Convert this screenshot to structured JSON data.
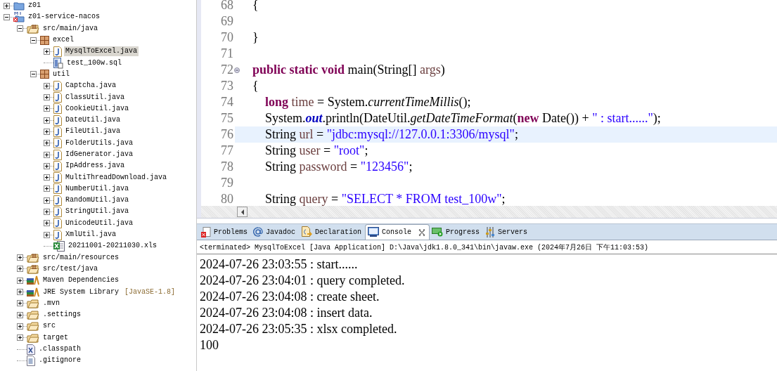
{
  "project_explorer": {
    "items": [
      {
        "label": "z01",
        "kind": "project",
        "expanded": false,
        "selected": false
      },
      {
        "label": "z01-service-nacos",
        "kind": "maven-project",
        "expanded": true,
        "selected": false,
        "children": [
          {
            "label": "src/main/java",
            "kind": "source-folder",
            "expanded": true,
            "selected": false,
            "children": [
              {
                "label": "excel",
                "kind": "package",
                "expanded": true,
                "selected": false,
                "children": [
                  {
                    "label": "MysqlToExcel.java",
                    "kind": "java",
                    "expanded": false,
                    "selected": true
                  },
                  {
                    "label": "test_100w.sql",
                    "kind": "sql",
                    "selected": false
                  }
                ]
              },
              {
                "label": "util",
                "kind": "package",
                "expanded": true,
                "selected": false,
                "children": [
                  {
                    "label": "Captcha.java",
                    "kind": "java",
                    "expanded": false,
                    "selected": false
                  },
                  {
                    "label": "ClassUtil.java",
                    "kind": "java",
                    "expanded": false,
                    "selected": false
                  },
                  {
                    "label": "CookieUtil.java",
                    "kind": "java",
                    "expanded": false,
                    "selected": false
                  },
                  {
                    "label": "DateUtil.java",
                    "kind": "java",
                    "expanded": false,
                    "selected": false
                  },
                  {
                    "label": "FileUtil.java",
                    "kind": "java",
                    "expanded": false,
                    "selected": false
                  },
                  {
                    "label": "FolderUtils.java",
                    "kind": "java",
                    "expanded": false,
                    "selected": false
                  },
                  {
                    "label": "IdGenerator.java",
                    "kind": "java",
                    "expanded": false,
                    "selected": false
                  },
                  {
                    "label": "IpAddress.java",
                    "kind": "java",
                    "expanded": false,
                    "selected": false
                  },
                  {
                    "label": "MultiThreadDownload.java",
                    "kind": "java",
                    "expanded": false,
                    "selected": false
                  },
                  {
                    "label": "NumberUtil.java",
                    "kind": "java",
                    "expanded": false,
                    "selected": false
                  },
                  {
                    "label": "RandomUtil.java",
                    "kind": "java",
                    "expanded": false,
                    "selected": false
                  },
                  {
                    "label": "StringUtil.java",
                    "kind": "java",
                    "expanded": false,
                    "selected": false
                  },
                  {
                    "label": "UnicodeUtil.java",
                    "kind": "java",
                    "expanded": false,
                    "selected": false
                  },
                  {
                    "label": "XmlUtil.java",
                    "kind": "java",
                    "expanded": false,
                    "selected": false
                  },
                  {
                    "label": "20211001-20211030.xls",
                    "kind": "xls",
                    "selected": false
                  }
                ]
              }
            ]
          },
          {
            "label": "src/main/resources",
            "kind": "source-folder",
            "expanded": false,
            "selected": false
          },
          {
            "label": "src/test/java",
            "kind": "source-folder",
            "expanded": false,
            "selected": false
          },
          {
            "label": "Maven Dependencies",
            "kind": "library",
            "expanded": false,
            "selected": false
          },
          {
            "label": "JRE System Library",
            "decoration": "[JavaSE-1.8]",
            "kind": "library",
            "expanded": false,
            "selected": false
          },
          {
            "label": ".mvn",
            "kind": "folder",
            "expanded": false,
            "selected": false
          },
          {
            "label": ".settings",
            "kind": "folder",
            "expanded": false,
            "selected": false
          },
          {
            "label": "src",
            "kind": "folder",
            "expanded": false,
            "selected": false
          },
          {
            "label": "target",
            "kind": "folder",
            "expanded": false,
            "selected": false
          },
          {
            "label": ".classpath",
            "kind": "xml",
            "selected": false
          },
          {
            "label": ".gitignore",
            "kind": "text",
            "selected": false
          }
        ]
      }
    ]
  },
  "editor": {
    "lines": [
      {
        "number": "68",
        "fold": false,
        "current": false,
        "tokens": [
          {
            "text": "{",
            "kind": "plain"
          }
        ]
      },
      {
        "number": "69",
        "fold": false,
        "current": false
      },
      {
        "number": "70",
        "fold": false,
        "current": false,
        "tokens": [
          {
            "text": "}",
            "kind": "plain"
          }
        ]
      },
      {
        "number": "71",
        "fold": false,
        "current": false
      },
      {
        "number": "72",
        "fold": true,
        "current": false,
        "tokens": [
          {
            "text": "public static void",
            "kind": "keyword"
          },
          {
            "text": " main(String[] ",
            "kind": "plain"
          },
          {
            "text": "args",
            "kind": "variable"
          },
          {
            "text": ")",
            "kind": "plain"
          }
        ]
      },
      {
        "number": "73",
        "fold": false,
        "current": false,
        "tokens": [
          {
            "text": "{",
            "kind": "plain"
          }
        ]
      },
      {
        "number": "74",
        "fold": false,
        "current": false,
        "tokens": [
          {
            "text": "    long",
            "kind": "keyword"
          },
          {
            "text": " time",
            "kind": "variable"
          },
          {
            "text": " = System.",
            "kind": "plain"
          },
          {
            "text": "currentTimeMillis",
            "kind": "static-method"
          },
          {
            "text": "();",
            "kind": "plain"
          }
        ]
      },
      {
        "number": "75",
        "fold": false,
        "current": false,
        "tokens": [
          {
            "text": "    System.",
            "kind": "plain"
          },
          {
            "text": "out",
            "kind": "static-field"
          },
          {
            "text": ".println(DateUtil.",
            "kind": "plain"
          },
          {
            "text": "getDateTimeFormat",
            "kind": "static-method"
          },
          {
            "text": "(",
            "kind": "plain"
          },
          {
            "text": "new",
            "kind": "keyword"
          },
          {
            "text": " Date()) + ",
            "kind": "plain"
          },
          {
            "text": "\" : start......\"",
            "kind": "string"
          },
          {
            "text": ");",
            "kind": "plain"
          }
        ]
      },
      {
        "number": "76",
        "fold": false,
        "current": true,
        "tokens": [
          {
            "text": "    String ",
            "kind": "plain"
          },
          {
            "text": "url",
            "kind": "variable"
          },
          {
            "text": " = ",
            "kind": "plain"
          },
          {
            "text": "\"jdbc:mysql://127.0.0.1:3306/mysql\"",
            "kind": "string"
          },
          {
            "text": ";",
            "kind": "plain"
          }
        ]
      },
      {
        "number": "77",
        "fold": false,
        "current": false,
        "tokens": [
          {
            "text": "    String ",
            "kind": "plain"
          },
          {
            "text": "user",
            "kind": "variable"
          },
          {
            "text": " = ",
            "kind": "plain"
          },
          {
            "text": "\"root\"",
            "kind": "string"
          },
          {
            "text": ";",
            "kind": "plain"
          }
        ]
      },
      {
        "number": "78",
        "fold": false,
        "current": false,
        "tokens": [
          {
            "text": "    String ",
            "kind": "plain"
          },
          {
            "text": "password",
            "kind": "variable"
          },
          {
            "text": " = ",
            "kind": "plain"
          },
          {
            "text": "\"123456\"",
            "kind": "string"
          },
          {
            "text": ";",
            "kind": "plain"
          }
        ]
      },
      {
        "number": "79",
        "fold": false,
        "current": false
      },
      {
        "number": "80",
        "fold": false,
        "current": false,
        "tokens": [
          {
            "text": "    String ",
            "kind": "plain"
          },
          {
            "text": "query",
            "kind": "variable"
          },
          {
            "text": " = ",
            "kind": "plain"
          },
          {
            "text": "\"SELECT * FROM test_100w\"",
            "kind": "string"
          },
          {
            "text": ";",
            "kind": "plain"
          }
        ]
      }
    ]
  },
  "bottom_panel": {
    "tabs": [
      {
        "label": "Problems",
        "kind": "problems",
        "selected": false
      },
      {
        "label": "Javadoc",
        "kind": "javadoc",
        "selected": false
      },
      {
        "label": "Declaration",
        "kind": "declaration",
        "selected": false
      },
      {
        "label": "Console",
        "kind": "console",
        "selected": true
      },
      {
        "label": "Progress",
        "kind": "progress",
        "selected": false
      },
      {
        "label": "Servers",
        "kind": "servers",
        "selected": false
      }
    ],
    "console_header": "<terminated> MysqlToExcel [Java Application] D:\\Java\\jdk1.8.0_341\\bin\\javaw.exe (2024年7月26日 下午11:03:53)",
    "console_output": [
      "2024-07-26 23:03:55 : start......",
      "2024-07-26 23:04:01 : query completed.",
      "2024-07-26 23:04:08 : create sheet.",
      "2024-07-26 23:04:08 : insert data.",
      "2024-07-26 23:05:35 : xlsx completed.",
      "100"
    ]
  }
}
